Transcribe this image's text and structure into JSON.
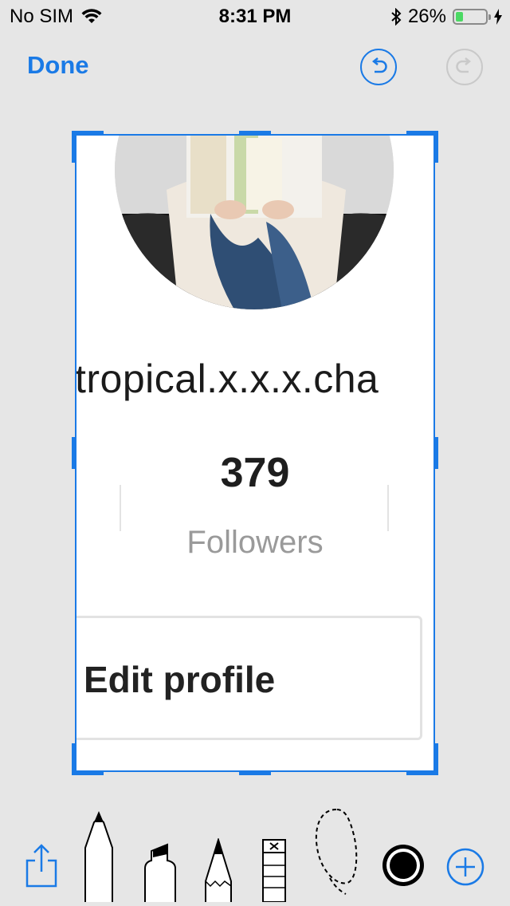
{
  "status_bar": {
    "carrier": "No SIM",
    "time": "8:31 PM",
    "battery_percent": "26%",
    "battery_level": 0.26,
    "battery_color": "#4cd964"
  },
  "nav": {
    "done_label": "Done",
    "undo_icon": "undo-arrow-icon",
    "redo_icon": "redo-arrow-icon",
    "accent": "#1a7ae6"
  },
  "profile": {
    "username": "tropical.x.x.x.cha",
    "followers_count": "379",
    "followers_label": "Followers",
    "edit_profile_label": "Edit profile"
  },
  "toolbar": {
    "tools": [
      "share-icon",
      "pen-tool-icon",
      "marker-tool-icon",
      "pencil-tool-icon",
      "eraser-tool-icon",
      "lasso-tool-icon",
      "color-picker-icon",
      "add-icon"
    ],
    "selected_color": "#000000"
  }
}
